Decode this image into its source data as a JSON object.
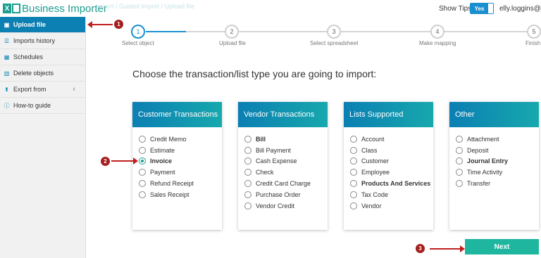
{
  "app": {
    "name": "Business Importer",
    "logo_glyph": "X"
  },
  "breadcrumb_faint": "Import  /  Guided Import  /  Upload file",
  "header": {
    "show_tips_label": "Show Tips",
    "toggle_value": "Yes",
    "user_email": "elly.loggins@g"
  },
  "sidebar": {
    "items": [
      {
        "label": "Upload file",
        "icon": "upload-file-icon",
        "glyph": "▣",
        "active": true
      },
      {
        "label": "Imports history",
        "icon": "list-icon",
        "glyph": "☰"
      },
      {
        "label": "Schedules",
        "icon": "calendar-icon",
        "glyph": "▦"
      },
      {
        "label": "Delete objects",
        "icon": "trash-icon",
        "glyph": "▥"
      },
      {
        "label": "Export from",
        "icon": "export-icon",
        "glyph": "⬆",
        "chevron": "‹"
      },
      {
        "label": "How-to guide",
        "icon": "info-icon",
        "glyph": "ⓘ"
      }
    ]
  },
  "stepper": {
    "steps": [
      {
        "number": "1",
        "label": "Select object",
        "active": true
      },
      {
        "number": "2",
        "label": "Upload file"
      },
      {
        "number": "3",
        "label": "Select spreadsheet"
      },
      {
        "number": "4",
        "label": "Make mapping"
      },
      {
        "number": "5",
        "label": "Finish"
      }
    ]
  },
  "main": {
    "heading": "Choose the transaction/list type you are going to import:",
    "cards": [
      {
        "title": "Customer Transactions",
        "options": [
          {
            "label": "Credit Memo"
          },
          {
            "label": "Estimate"
          },
          {
            "label": "Invoice",
            "bold": true,
            "checked": true
          },
          {
            "label": "Payment"
          },
          {
            "label": "Refund Receipt"
          },
          {
            "label": "Sales Receipt"
          }
        ]
      },
      {
        "title": "Vendor Transactions",
        "options": [
          {
            "label": "Bill",
            "bold": true
          },
          {
            "label": "Bill Payment"
          },
          {
            "label": "Cash Expense"
          },
          {
            "label": "Check"
          },
          {
            "label": "Credit Card Charge"
          },
          {
            "label": "Purchase Order"
          },
          {
            "label": "Vendor Credit"
          }
        ]
      },
      {
        "title": "Lists Supported",
        "options": [
          {
            "label": "Account"
          },
          {
            "label": "Class"
          },
          {
            "label": "Customer"
          },
          {
            "label": "Employee"
          },
          {
            "label": "Products And Services",
            "bold": true
          },
          {
            "label": "Tax Code"
          },
          {
            "label": "Vendor"
          }
        ]
      },
      {
        "title": "Other",
        "options": [
          {
            "label": "Attachment"
          },
          {
            "label": "Deposit"
          },
          {
            "label": "Journal Entry",
            "bold": true
          },
          {
            "label": "Time Activity"
          },
          {
            "label": "Transfer"
          }
        ]
      }
    ],
    "next_label": "Next"
  },
  "annotations": {
    "badge1": "1",
    "badge2": "2",
    "badge3": "3"
  },
  "colors": {
    "accent": "#1a9e8f",
    "primary_blue": "#0d80b3",
    "next_button": "#1fb6a0",
    "annotation": "#a51d1d"
  }
}
